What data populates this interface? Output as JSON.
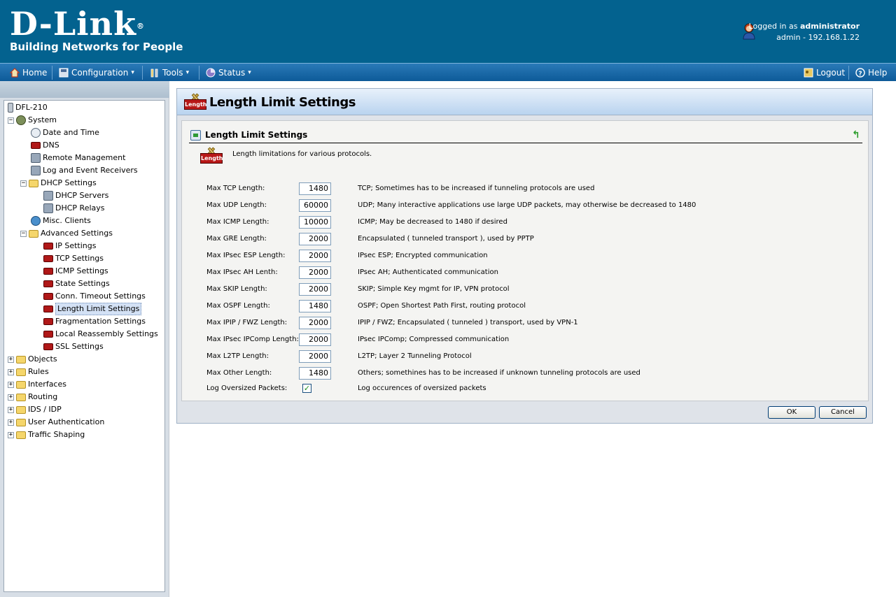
{
  "brand": {
    "name": "D-Link",
    "reg": "®",
    "tagline": "Building Networks for People"
  },
  "user": {
    "prefix": "Logged in as ",
    "name": "administrator",
    "host": "admin - 192.168.1.22"
  },
  "menu": {
    "home": "Home",
    "configuration": "Configuration",
    "tools": "Tools",
    "status": "Status",
    "logout": "Logout",
    "help": "Help",
    "caret": "▾"
  },
  "tree": {
    "root": "DFL-210",
    "system": "System",
    "date_time": "Date and Time",
    "dns": "DNS",
    "remote_mgmt": "Remote Management",
    "log_receivers": "Log and Event Receivers",
    "dhcp_settings": "DHCP Settings",
    "dhcp_servers": "DHCP Servers",
    "dhcp_relays": "DHCP Relays",
    "misc_clients": "Misc. Clients",
    "advanced": "Advanced Settings",
    "ip_settings": "IP Settings",
    "tcp_settings": "TCP Settings",
    "icmp_settings": "ICMP Settings",
    "state_settings": "State Settings",
    "conn_timeout": "Conn. Timeout Settings",
    "length_limit": "Length Limit Settings",
    "fragmentation": "Fragmentation Settings",
    "local_reassembly": "Local Reassembly Settings",
    "ssl_settings": "SSL Settings",
    "objects": "Objects",
    "rules": "Rules",
    "interfaces": "Interfaces",
    "routing": "Routing",
    "ids_idp": "IDS / IDP",
    "user_auth": "User Authentication",
    "traffic_shaping": "Traffic Shaping",
    "plus": "+",
    "minus": "−"
  },
  "page": {
    "title": "Length Limit Settings",
    "panel_title": "Length Limit Settings",
    "icon_text": "Length",
    "description": "Length limitations for various protocols.",
    "back": "↰"
  },
  "settings": [
    {
      "label": "Max TCP Length:",
      "value": "1480",
      "hint": "TCP; Sometimes has to be increased if tunneling protocols are used"
    },
    {
      "label": "Max UDP Length:",
      "value": "60000",
      "hint": "UDP; Many interactive applications use large UDP packets, may otherwise be decreased to 1480"
    },
    {
      "label": "Max ICMP Length:",
      "value": "10000",
      "hint": "ICMP; May be decreased to 1480 if desired"
    },
    {
      "label": "Max GRE Length:",
      "value": "2000",
      "hint": "Encapsulated ( tunneled transport ), used by PPTP"
    },
    {
      "label": "Max IPsec ESP Length:",
      "value": "2000",
      "hint": "IPsec ESP; Encrypted communication"
    },
    {
      "label": "Max IPsec AH Lenth:",
      "value": "2000",
      "hint": "IPsec AH; Authenticated communication"
    },
    {
      "label": "Max SKIP Length:",
      "value": "2000",
      "hint": "SKIP; Simple Key mgmt for IP, VPN protocol"
    },
    {
      "label": "Max OSPF Length:",
      "value": "1480",
      "hint": "OSPF; Open Shortest Path First, routing protocol"
    },
    {
      "label": "Max IPIP / FWZ Length:",
      "value": "2000",
      "hint": "IPIP / FWZ; Encapsulated ( tunneled ) transport, used by VPN-1"
    },
    {
      "label": "Max IPsec IPComp Length:",
      "value": "2000",
      "hint": "IPsec IPComp; Compressed communication"
    },
    {
      "label": "Max L2TP Length:",
      "value": "2000",
      "hint": "L2TP; Layer 2 Tunneling Protocol"
    },
    {
      "label": "Max Other Length:",
      "value": "1480",
      "hint": "Others; somethines has to be increased if unknown tunneling protocols are used"
    }
  ],
  "log_oversized": {
    "label": "Log Oversized Packets:",
    "checked_mark": "✓",
    "hint": "Log occurences of oversized packets"
  },
  "buttons": {
    "ok": "OK",
    "cancel": "Cancel"
  }
}
